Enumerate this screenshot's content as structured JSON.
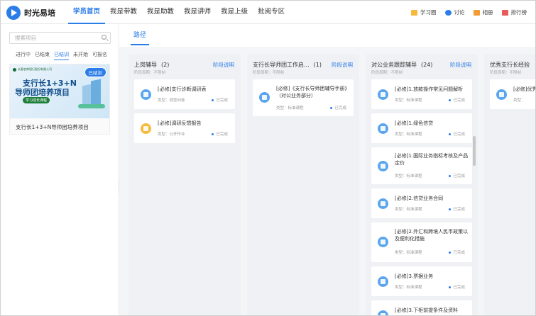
{
  "app": {
    "title": "时光易培"
  },
  "nav": [
    {
      "label": "学员首页",
      "active": true
    },
    {
      "label": "我是带教",
      "active": false
    },
    {
      "label": "我是助教",
      "active": false
    },
    {
      "label": "我是讲师",
      "active": false
    },
    {
      "label": "我是上级",
      "active": false
    },
    {
      "label": "批阅专区",
      "active": false
    }
  ],
  "tools": [
    {
      "label": "学习圈",
      "icon": "study-circle-icon",
      "color": "#f6b93b"
    },
    {
      "label": "讨论",
      "icon": "discussion-icon",
      "color": "#2b7de9"
    },
    {
      "label": "相册",
      "icon": "album-icon",
      "color": "#f39c34"
    },
    {
      "label": "排行榜",
      "icon": "ranking-icon",
      "color": "#e95a5a"
    }
  ],
  "sidebar": {
    "search_placeholder": "搜索项目",
    "filters": [
      {
        "label": "进行中",
        "active": false
      },
      {
        "label": "已结束",
        "active": false
      },
      {
        "label": "已结训",
        "active": true
      },
      {
        "label": "未开始",
        "active": false
      },
      {
        "label": "可报名",
        "active": false
      }
    ],
    "course": {
      "badge": "已结训",
      "banner_org": "长春农商银行股份有限公司",
      "banner_line1": "支行长1+3+N",
      "banner_line2": "导师团培养项目",
      "banner_pill": "学习成长课程",
      "name": "支行长1+3+N导师团培养项目"
    }
  },
  "main": {
    "tab": "路径",
    "stages": [
      {
        "title": "上岗辅导",
        "count": "(2)",
        "link": "阶段说明",
        "sub": "阶段周期：不限制",
        "items": [
          {
            "title": "[必修]支行诊断调研表",
            "type": "类型：调查问卷",
            "status": "已完成",
            "icon": "survey-icon",
            "color": "blue"
          },
          {
            "title": "[必修]调研反馈报告",
            "type": "类型：公开作业",
            "status": "已完成",
            "icon": "homework-icon",
            "color": "yellow"
          }
        ]
      },
      {
        "title": "支行长导师团工作启...",
        "count": "(1)",
        "link": "阶段说明",
        "sub": "阶段周期：不限制",
        "items": [
          {
            "title": "[必修]《支行长导师团辅导手册》（对公业务部分）",
            "type": "类型：标准课程",
            "status": "已完成",
            "icon": "course-icon",
            "color": "blue"
          }
        ]
      },
      {
        "title": "对公业务跟踪辅导",
        "count": "(24)",
        "link": "阶段说明",
        "sub": "阶段周期：不限制",
        "items": [
          {
            "title": "[必修]1.放款操作常见问题解析",
            "type": "类型：标准课程",
            "status": "已完成",
            "icon": "course-icon",
            "color": "blue"
          },
          {
            "title": "[必修]1.绿色信贷",
            "type": "类型：标准课程",
            "status": "已完成",
            "icon": "course-icon",
            "color": "blue"
          },
          {
            "title": "[必修]1.国际业务指标考核及产品定价",
            "type": "类型：标准课程",
            "status": "已完成",
            "icon": "course-icon",
            "color": "blue"
          },
          {
            "title": "[必修]2.信贷业务合同",
            "type": "类型：标准课程",
            "status": "已完成",
            "icon": "course-icon",
            "color": "blue"
          },
          {
            "title": "[必修]2.外汇和跨境人民币政策以及便利化措施",
            "type": "类型：标准课程",
            "status": "已完成",
            "icon": "course-icon",
            "color": "blue"
          },
          {
            "title": "[必修]3.票据业务",
            "type": "类型：标准课程",
            "status": "已完成",
            "icon": "course-icon",
            "color": "blue"
          },
          {
            "title": "[必修]3.下柜前提条件及资料",
            "type": "",
            "status": "",
            "icon": "course-icon",
            "color": "blue"
          }
        ]
      },
      {
        "title": "优秀支行长经验",
        "count": "",
        "link": "",
        "sub": "阶段周期：不限制",
        "items": [
          {
            "title": "[必修]优秀",
            "type": "类型：",
            "status": "",
            "icon": "course-icon",
            "color": "blue"
          }
        ]
      }
    ]
  }
}
